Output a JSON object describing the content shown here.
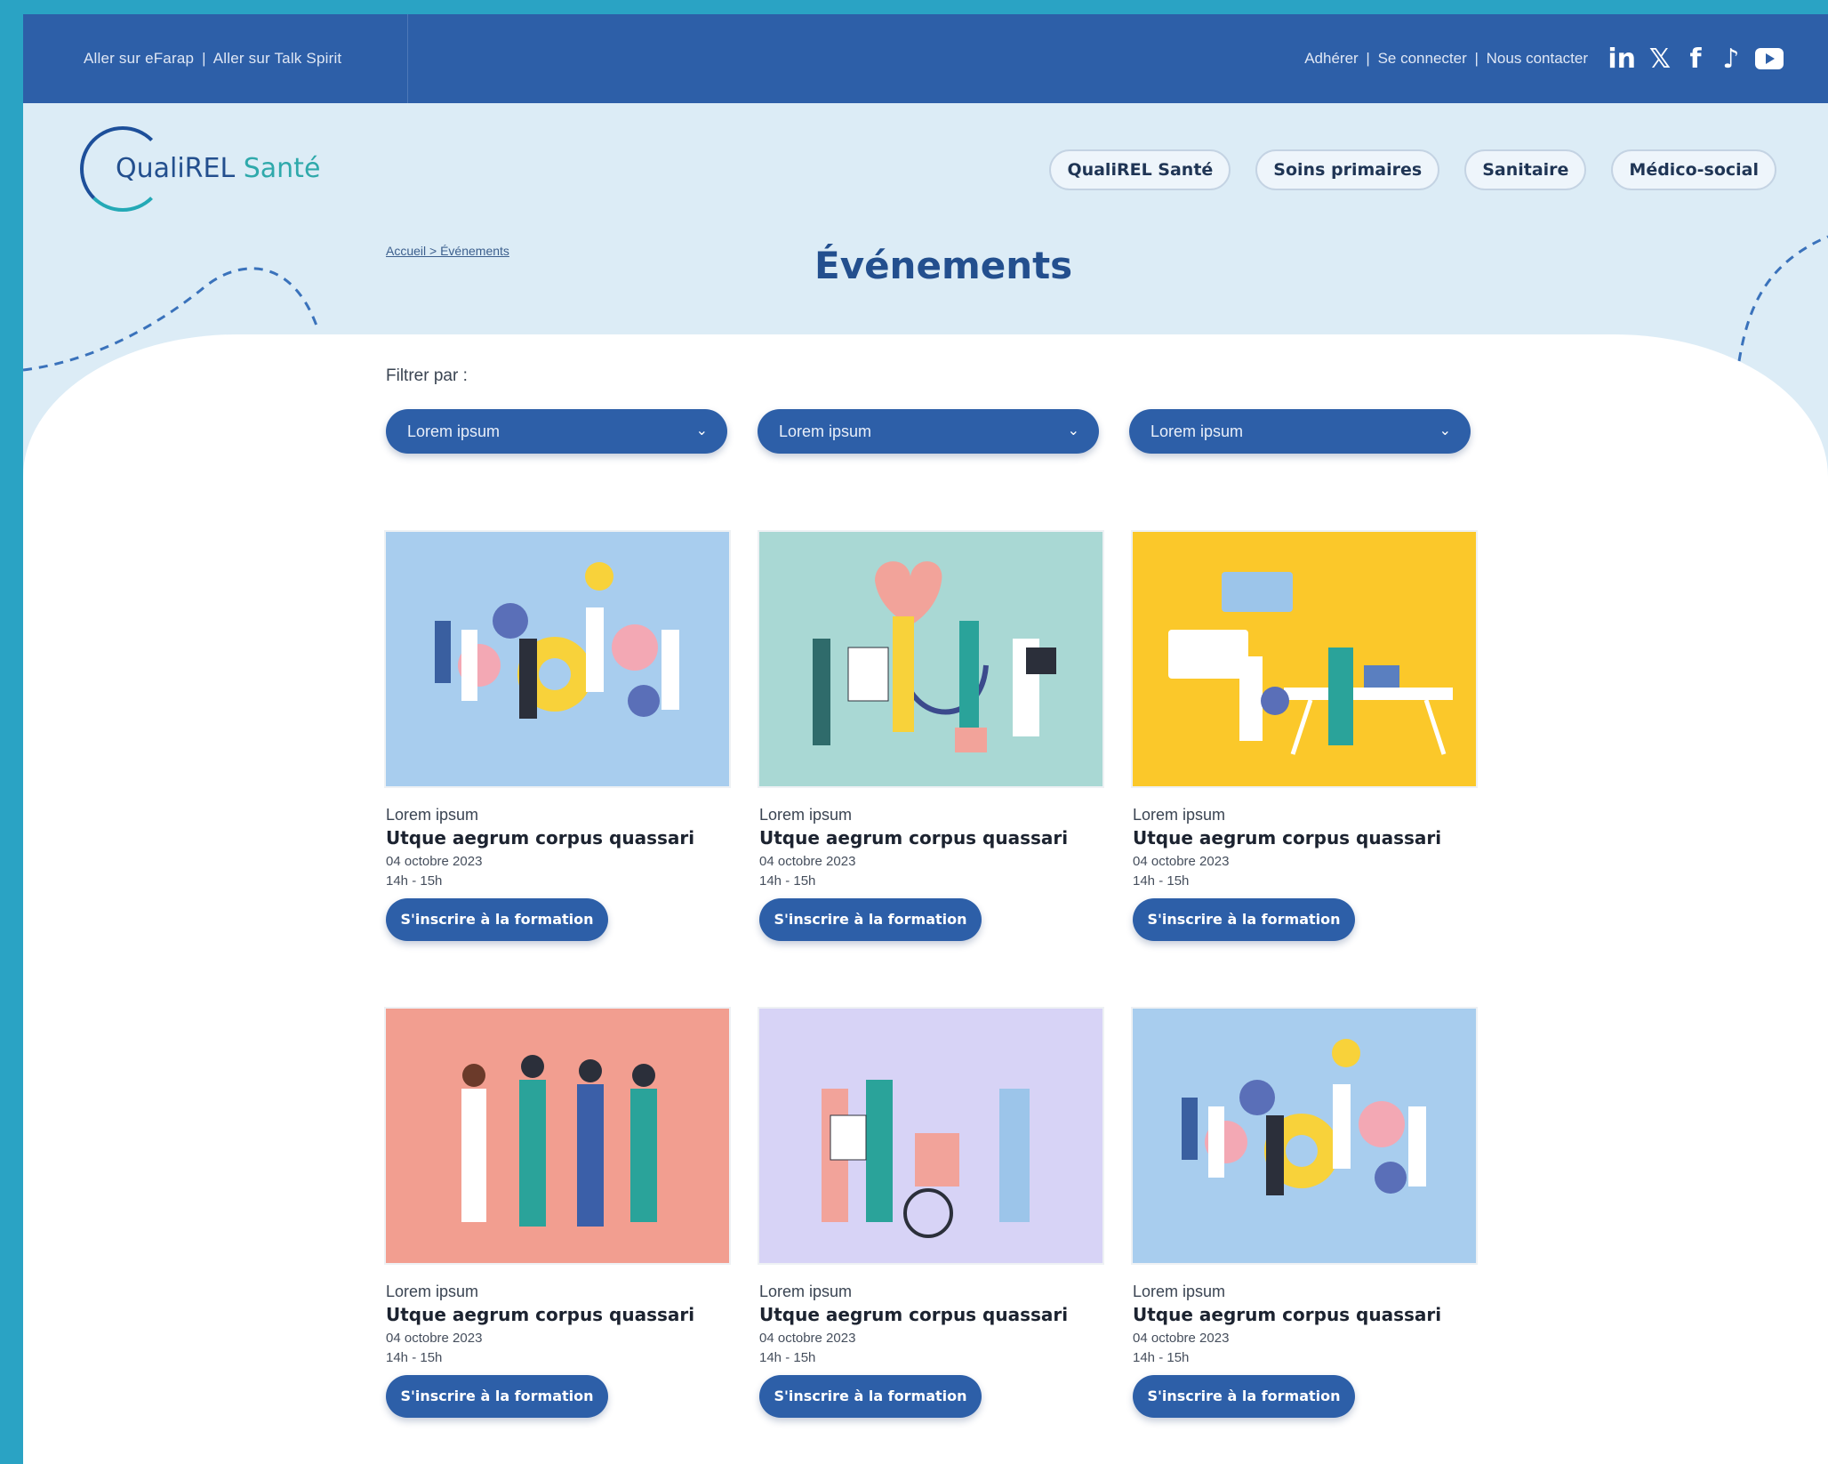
{
  "topbar": {
    "link_efarap": "Aller sur eFarap",
    "link_talkspirit": "Aller sur Talk Spirit",
    "link_adherer": "Adhérer",
    "link_connect": "Se connecter",
    "link_contact": "Nous contacter",
    "divider": "|",
    "socials": [
      "linkedin-icon",
      "x-icon",
      "facebook-icon",
      "tiktok-icon",
      "youtube-icon"
    ]
  },
  "logo": {
    "name_main": "QualiREL ",
    "name_accent": "Santé"
  },
  "nav": [
    "QualiREL Santé",
    "Soins primaires",
    "Sanitaire",
    "Médico-social"
  ],
  "breadcrumb": "Accueil > Événements",
  "page_title": "Événements",
  "filters": {
    "label": "Filtrer par :",
    "options": [
      "Lorem ipsum",
      "Lorem ipsum",
      "Lorem ipsum"
    ]
  },
  "cards": [
    {
      "kicker": "Lorem ipsum",
      "title": "Utque aegrum corpus quassari",
      "date": "04 octobre 2023",
      "time": "14h - 15h",
      "button": "S'inscrire à la formation",
      "bg": "#a8cdee"
    },
    {
      "kicker": "Lorem ipsum",
      "title": "Utque aegrum corpus quassari",
      "date": "04 octobre 2023",
      "time": "14h - 15h",
      "button": "S'inscrire à la formation",
      "bg": "#a9d8d4"
    },
    {
      "kicker": "Lorem ipsum",
      "title": "Utque aegrum corpus quassari",
      "date": "04 octobre 2023",
      "time": "14h - 15h",
      "button": "S'inscrire à la formation",
      "bg": "#fbc82a"
    },
    {
      "kicker": "Lorem ipsum",
      "title": "Utque aegrum corpus quassari",
      "date": "04 octobre 2023",
      "time": "14h - 15h",
      "button": "S'inscrire à la formation",
      "bg": "#f29e90"
    },
    {
      "kicker": "Lorem ipsum",
      "title": "Utque aegrum corpus quassari",
      "date": "04 octobre 2023",
      "time": "14h - 15h",
      "button": "S'inscrire à la formation",
      "bg": "#d7d3f6"
    },
    {
      "kicker": "Lorem ipsum",
      "title": "Utque aegrum corpus quassari",
      "date": "04 octobre 2023",
      "time": "14h - 15h",
      "button": "S'inscrire à la formation",
      "bg": "#a8cdee"
    }
  ]
}
